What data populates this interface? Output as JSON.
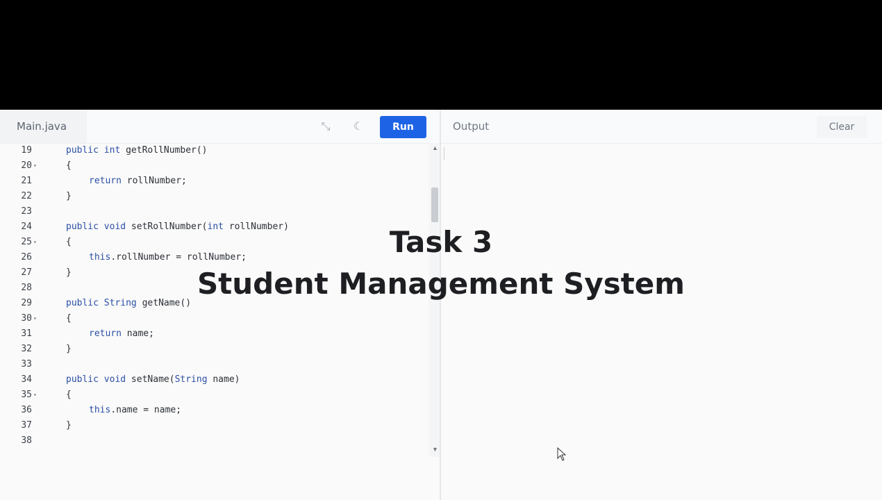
{
  "editor": {
    "file_tab": "Main.java",
    "icons": {
      "fullscreen": "collapse-icon",
      "theme": "moon-icon"
    },
    "run_label": "Run",
    "lines": [
      {
        "n": "19",
        "fold": false,
        "indent": 0,
        "tokens": [
          [
            "kw",
            "public"
          ],
          [
            "p",
            " "
          ],
          [
            "kw",
            "int"
          ],
          [
            "p",
            " getRollNumber()"
          ]
        ]
      },
      {
        "n": "20",
        "fold": true,
        "indent": 0,
        "tokens": [
          [
            "p",
            "{"
          ]
        ]
      },
      {
        "n": "21",
        "fold": false,
        "indent": 1,
        "tokens": [
          [
            "kw",
            "return"
          ],
          [
            "p",
            " rollNumber;"
          ]
        ]
      },
      {
        "n": "22",
        "fold": false,
        "indent": 0,
        "tokens": [
          [
            "p",
            "}"
          ]
        ]
      },
      {
        "n": "23",
        "fold": false,
        "indent": 0,
        "tokens": []
      },
      {
        "n": "24",
        "fold": false,
        "indent": 0,
        "tokens": [
          [
            "kw",
            "public"
          ],
          [
            "p",
            " "
          ],
          [
            "kw",
            "void"
          ],
          [
            "p",
            " setRollNumber("
          ],
          [
            "kw",
            "int"
          ],
          [
            "p",
            " rollNumber)"
          ]
        ]
      },
      {
        "n": "25",
        "fold": true,
        "indent": 0,
        "tokens": [
          [
            "p",
            "{"
          ]
        ]
      },
      {
        "n": "26",
        "fold": false,
        "indent": 1,
        "tokens": [
          [
            "kw",
            "this"
          ],
          [
            "p",
            ".rollNumber = rollNumber;"
          ]
        ]
      },
      {
        "n": "27",
        "fold": false,
        "indent": 0,
        "tokens": [
          [
            "p",
            "}"
          ]
        ]
      },
      {
        "n": "28",
        "fold": false,
        "indent": 0,
        "tokens": []
      },
      {
        "n": "29",
        "fold": false,
        "indent": 0,
        "tokens": [
          [
            "kw",
            "public"
          ],
          [
            "p",
            " "
          ],
          [
            "kw",
            "String"
          ],
          [
            "p",
            " getName()"
          ]
        ]
      },
      {
        "n": "30",
        "fold": true,
        "indent": 0,
        "tokens": [
          [
            "p",
            "{"
          ]
        ]
      },
      {
        "n": "31",
        "fold": false,
        "indent": 1,
        "tokens": [
          [
            "kw",
            "return"
          ],
          [
            "p",
            " name;"
          ]
        ]
      },
      {
        "n": "32",
        "fold": false,
        "indent": 0,
        "tokens": [
          [
            "p",
            "}"
          ]
        ]
      },
      {
        "n": "33",
        "fold": false,
        "indent": 0,
        "tokens": []
      },
      {
        "n": "34",
        "fold": false,
        "indent": 0,
        "tokens": [
          [
            "kw",
            "public"
          ],
          [
            "p",
            " "
          ],
          [
            "kw",
            "void"
          ],
          [
            "p",
            " setName("
          ],
          [
            "kw",
            "String"
          ],
          [
            "p",
            " name)"
          ]
        ]
      },
      {
        "n": "35",
        "fold": true,
        "indent": 0,
        "tokens": [
          [
            "p",
            "{"
          ]
        ]
      },
      {
        "n": "36",
        "fold": false,
        "indent": 1,
        "tokens": [
          [
            "kw",
            "this"
          ],
          [
            "p",
            ".name = name;"
          ]
        ]
      },
      {
        "n": "37",
        "fold": false,
        "indent": 0,
        "tokens": [
          [
            "p",
            "}"
          ]
        ]
      },
      {
        "n": "38",
        "fold": false,
        "indent": 0,
        "tokens": []
      }
    ]
  },
  "output": {
    "title": "Output",
    "clear_label": "Clear"
  },
  "overlay": {
    "line1": "Task 3",
    "line2": "Student Management System"
  },
  "colors": {
    "run_button": "#1d63e6",
    "keyword": "#2a4fa5"
  }
}
